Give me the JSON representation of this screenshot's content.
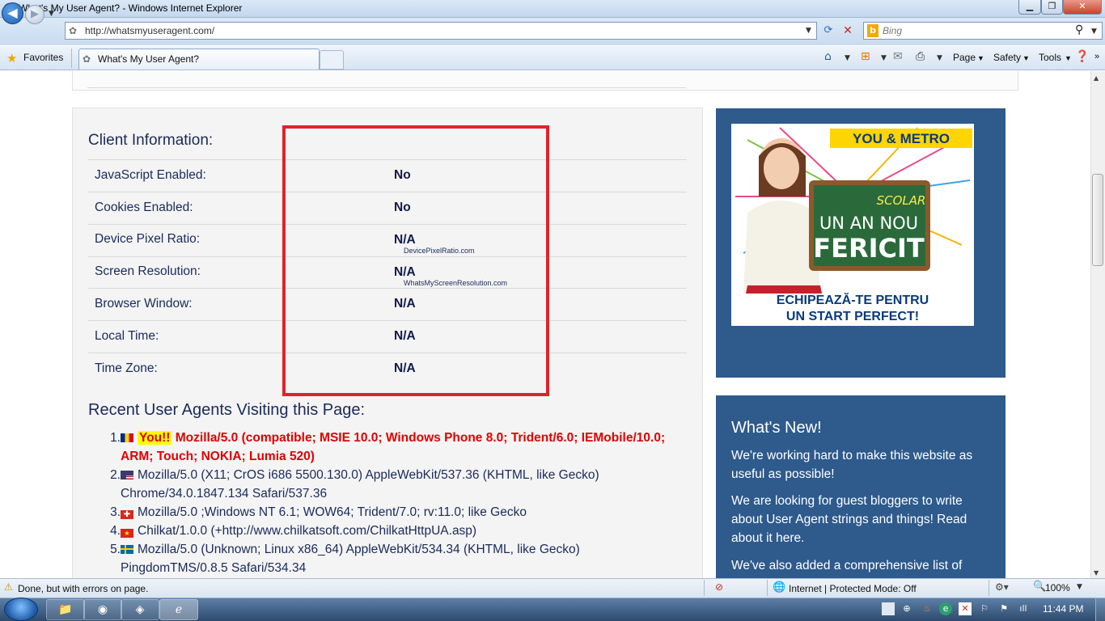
{
  "window": {
    "title": "What's My User Agent? - Windows Internet Explorer",
    "minimize_label": "▁",
    "maximize_label": "❐",
    "close_label": "✕"
  },
  "address_bar": {
    "url": "http://whatsmyuseragent.com/",
    "search_placeholder": "Bing"
  },
  "favorites_bar": {
    "favorites_label": "Favorites",
    "tab_title": "What's My User Agent?",
    "commands": [
      "Page",
      "Safety",
      "Tools"
    ]
  },
  "client_info": {
    "title": "Client Information:",
    "rows": [
      {
        "label": "JavaScript Enabled:",
        "value": "No",
        "sub": ""
      },
      {
        "label": "Cookies Enabled:",
        "value": "No",
        "sub": ""
      },
      {
        "label": "Device Pixel Ratio:",
        "value": "N/A",
        "sub": "DevicePixelRatio.com"
      },
      {
        "label": "Screen Resolution:",
        "value": "N/A",
        "sub": "WhatsMyScreenResolution.com"
      },
      {
        "label": "Browser Window:",
        "value": "N/A",
        "sub": ""
      },
      {
        "label": "Local Time:",
        "value": "N/A",
        "sub": ""
      },
      {
        "label": "Time Zone:",
        "value": "N/A",
        "sub": ""
      }
    ]
  },
  "recent": {
    "title": "Recent User Agents Visiting this Page:",
    "items": [
      {
        "num": "1.",
        "badge": "You!!",
        "text": "Mozilla/5.0 (compatible; MSIE 10.0; Windows Phone 8.0; Trident/6.0; IEMobile/10.0; ARM; Touch; NOKIA; Lumia 520)",
        "flag": "romania"
      },
      {
        "num": "2.",
        "text": "Mozilla/5.0 (X11; CrOS i686 5500.130.0) AppleWebKit/537.36 (KHTML, like Gecko) Chrome/34.0.1847.134 Safari/537.36",
        "flag": "usa"
      },
      {
        "num": "3.",
        "text": "Mozilla/5.0 ;Windows NT 6.1; WOW64; Trident/7.0; rv:11.0; like Gecko",
        "flag": "switzerland"
      },
      {
        "num": "4.",
        "text": "Chilkat/1.0.0 (+http://www.chilkatsoft.com/ChilkatHttpUA.asp)",
        "flag": "vietnam"
      },
      {
        "num": "5.",
        "text": "Mozilla/5.0 (Unknown; Linux x86_64) AppleWebKit/534.34 (KHTML, like Gecko) PingdomTMS/0.8.5 Safari/534.34",
        "flag": "sweden"
      }
    ]
  },
  "ad": {
    "brand": "YOU & METRO",
    "board_top": "SCOLAR",
    "board_line1": "UN AN  NOU",
    "board_line2": "FERICIT",
    "tagline1": "ECHIPEAZĂ-TE PENTRU",
    "tagline2": "UN START PERFECT!"
  },
  "whats_new": {
    "title": "What's New!",
    "p1": "We're working hard to make this website as useful as possible!",
    "p2": "We are looking for guest bloggers to write about User Agent strings and things! Read about it here.",
    "p3": "We've also added a comprehensive list of"
  },
  "status": {
    "text": "Done, but with errors on page.",
    "zone": "Internet | Protected Mode: Off",
    "zoom": "100%"
  },
  "taskbar": {
    "clock": "11:44 PM"
  },
  "colors": {
    "accent_red": "#e0232a",
    "panel_blue": "#2e5a8c",
    "text_navy": "#1a2a5a"
  }
}
